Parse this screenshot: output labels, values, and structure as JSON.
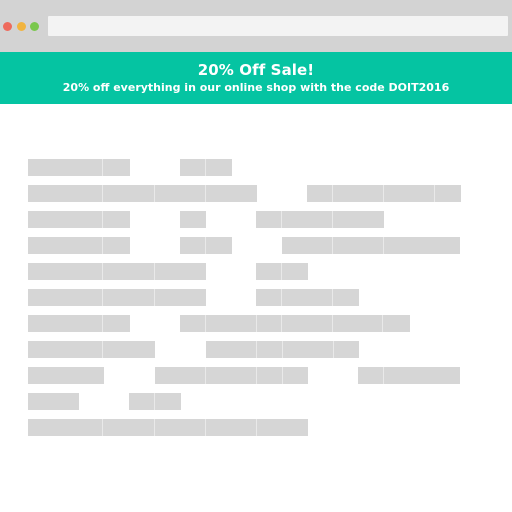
{
  "browser": {
    "controls": [
      {
        "name": "close",
        "color": "#ee6a5c"
      },
      {
        "name": "minimize",
        "color": "#f1b43f"
      },
      {
        "name": "maximize",
        "color": "#7ac74d"
      }
    ],
    "address_bar_value": ""
  },
  "banner": {
    "title": "20% Off Sale!",
    "subtitle": "20% off everything in our online shop with the code DOIT2016",
    "background_color": "#05c4a2",
    "text_color": "#ffffff"
  },
  "placeholder": {
    "color": "#d6d6d6"
  }
}
